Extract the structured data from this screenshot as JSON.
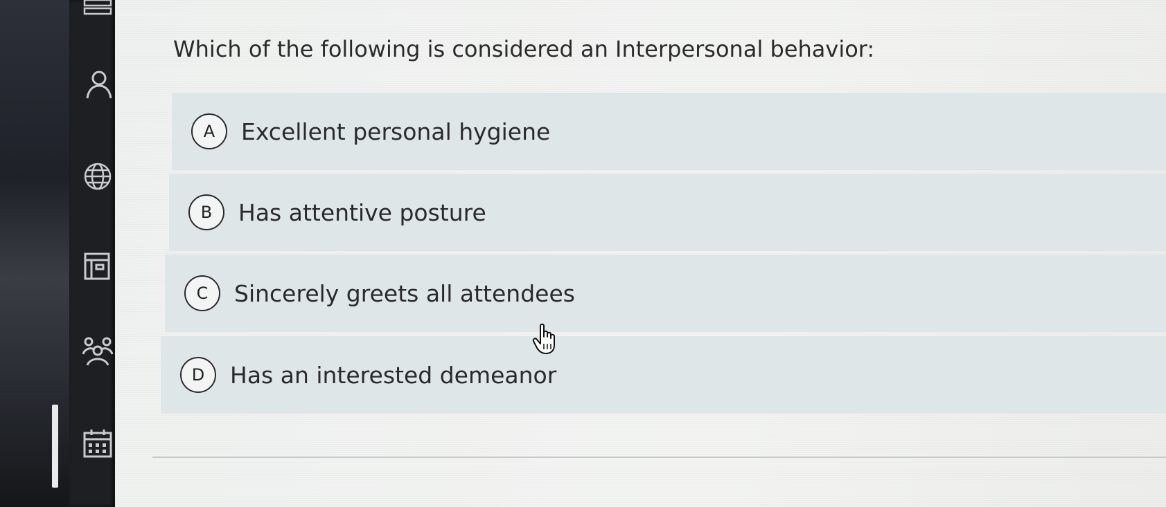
{
  "question": {
    "text": "Which of the following is considered an Interpersonal behavior:"
  },
  "options": [
    {
      "letter": "A",
      "label": "Excellent personal hygiene"
    },
    {
      "letter": "B",
      "label": "Has attentive posture"
    },
    {
      "letter": "C",
      "label": "Sincerely greets all attendees"
    },
    {
      "letter": "D",
      "label": "Has an interested demeanor"
    }
  ],
  "sidebar": {
    "icons": [
      "library-icon",
      "person-icon",
      "globe-icon",
      "document-icon",
      "people-icon",
      "calendar-icon"
    ]
  },
  "colors": {
    "sidebar": "#1d1f22",
    "option_background": "#dfe6e7",
    "page_background": "#f1f2f0",
    "text": "#2a2a2a"
  }
}
